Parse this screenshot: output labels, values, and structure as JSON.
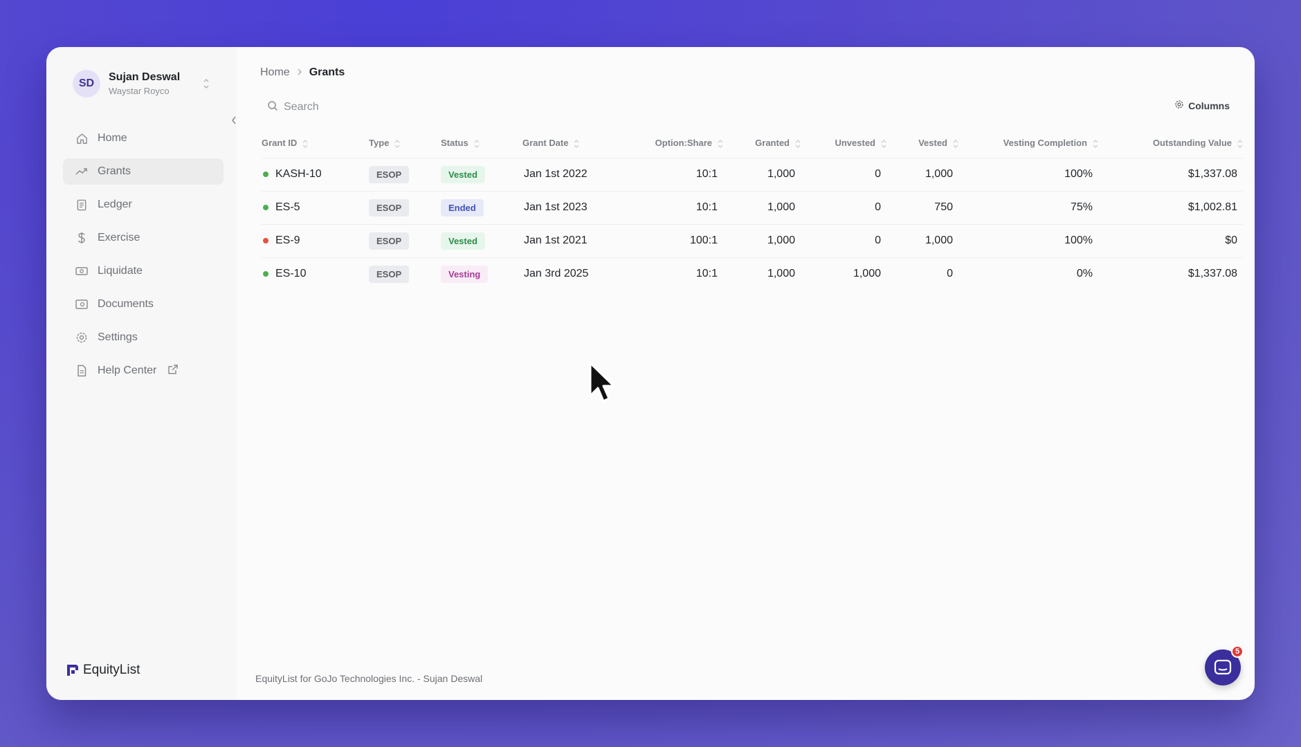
{
  "user": {
    "initials": "SD",
    "name": "Sujan Deswal",
    "org": "Waystar Royco"
  },
  "nav": [
    {
      "label": "Home",
      "icon": "home-icon",
      "active": false
    },
    {
      "label": "Grants",
      "icon": "trend-icon",
      "active": true
    },
    {
      "label": "Ledger",
      "icon": "ledger-icon",
      "active": false
    },
    {
      "label": "Exercise",
      "icon": "dollar-icon",
      "active": false
    },
    {
      "label": "Liquidate",
      "icon": "cash-icon",
      "active": false
    },
    {
      "label": "Documents",
      "icon": "documents-icon",
      "active": false
    },
    {
      "label": "Settings",
      "icon": "gear-icon",
      "active": false
    },
    {
      "label": "Help Center",
      "icon": "file-icon",
      "active": false
    }
  ],
  "brand": "EquityList",
  "breadcrumb": {
    "home": "Home",
    "current": "Grants"
  },
  "search": {
    "placeholder": "Search",
    "value": ""
  },
  "columns_button": "Columns",
  "table": {
    "headers": [
      "Grant ID",
      "Type",
      "Status",
      "Grant Date",
      "Option:Share",
      "Granted",
      "Unvested",
      "Vested",
      "Vesting Completion",
      "Outstanding Value"
    ],
    "rows": [
      {
        "grant_id": "KASH-10",
        "dot_color": "#4caf50",
        "type": "ESOP",
        "status": "Vested",
        "status_bg": "#e7f6ec",
        "status_fg": "#2e8b4a",
        "grant_date": "Jan 1st 2022",
        "option_share": "10:1",
        "granted": "1,000",
        "unvested": "0",
        "vested": "1,000",
        "vesting_completion": "100%",
        "outstanding_value": "$1,337.08"
      },
      {
        "grant_id": "ES-5",
        "dot_color": "#4caf50",
        "type": "ESOP",
        "status": "Ended",
        "status_bg": "#e6e9f8",
        "status_fg": "#3f51b5",
        "grant_date": "Jan 1st 2023",
        "option_share": "10:1",
        "granted": "1,000",
        "unvested": "0",
        "vested": "750",
        "vesting_completion": "75%",
        "outstanding_value": "$1,002.81"
      },
      {
        "grant_id": "ES-9",
        "dot_color": "#e5533d",
        "type": "ESOP",
        "status": "Vested",
        "status_bg": "#e7f6ec",
        "status_fg": "#2e8b4a",
        "grant_date": "Jan 1st 2021",
        "option_share": "100:1",
        "granted": "1,000",
        "unvested": "0",
        "vested": "1,000",
        "vesting_completion": "100%",
        "outstanding_value": "$0"
      },
      {
        "grant_id": "ES-10",
        "dot_color": "#4caf50",
        "type": "ESOP",
        "status": "Vesting",
        "status_bg": "#f8ecf6",
        "status_fg": "#a63d96",
        "grant_date": "Jan 3rd 2025",
        "option_share": "10:1",
        "granted": "1,000",
        "unvested": "1,000",
        "vested": "0",
        "vesting_completion": "0%",
        "outstanding_value": "$1,337.08"
      }
    ]
  },
  "footer": "EquityList for GoJo Technologies Inc. - Sujan Deswal",
  "chat": {
    "badge_count": "5"
  },
  "colors": {
    "accent": "#3a2f9c",
    "background": "#5548cf"
  }
}
